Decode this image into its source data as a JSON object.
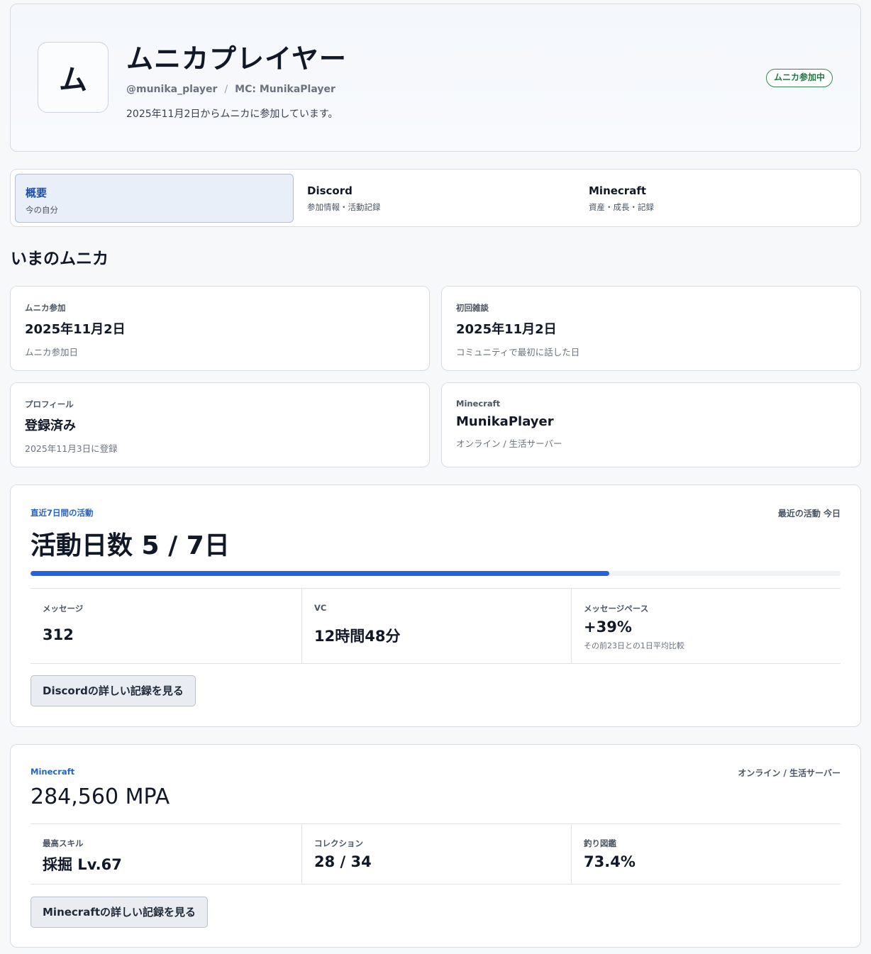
{
  "profile": {
    "avatar_initial": "ム",
    "name": "ムニカプレイヤー",
    "handle": "@munika_player",
    "separator": "/",
    "mc_name": "MC: MunikaPlayer",
    "since": "2025年11月2日からムニカに参加しています。",
    "badge": "ムニカ参加中",
    "badge_color": "#2f8a4f"
  },
  "tabs": [
    {
      "title": "概要",
      "sub": "今の自分"
    },
    {
      "title": "Discord",
      "sub": "参加情報・活動記録"
    },
    {
      "title": "Minecraft",
      "sub": "資産・成長・記録"
    }
  ],
  "section_title": "いまのムニカ",
  "info_cards": [
    {
      "label": "ムニカ参加",
      "value": "2025年11月2日",
      "note": "ムニカ参加日"
    },
    {
      "label": "初回雑談",
      "value": "2025年11月2日",
      "note": "コミュニティで最初に話した日"
    },
    {
      "label": "プロフィール",
      "value": "登録済み",
      "note": "2025年11月3日に登録"
    },
    {
      "label": "Minecraft",
      "value": "MunikaPlayer",
      "note": "オンライン / 生活サーバー"
    }
  ],
  "activity": {
    "label": "直近7日間の活動",
    "recent": "最近の活動 今日",
    "title": "活動日数 5 / 7日",
    "active_days": 5,
    "total_days": 7,
    "stats": [
      {
        "label": "メッセージ",
        "value": "312",
        "note": ""
      },
      {
        "label": "VC",
        "value": "12時間48分",
        "note": ""
      },
      {
        "label": "メッセージペース",
        "value": "+39%",
        "note": "その前23日との1日平均比較"
      }
    ],
    "button": "Discordの詳しい記録を見る",
    "accent_color": "#2563dc"
  },
  "minecraft": {
    "label": "Minecraft",
    "status": "オンライン / 生活サーバー",
    "mpa": "284,560 MPA",
    "stats": [
      {
        "label": "最高スキル",
        "value": "採掘 Lv.67"
      },
      {
        "label": "コレクション",
        "value": "28 / 34"
      },
      {
        "label": "釣り図鑑",
        "value": "73.4%"
      }
    ],
    "button": "Minecraftの詳しい記録を見る"
  }
}
